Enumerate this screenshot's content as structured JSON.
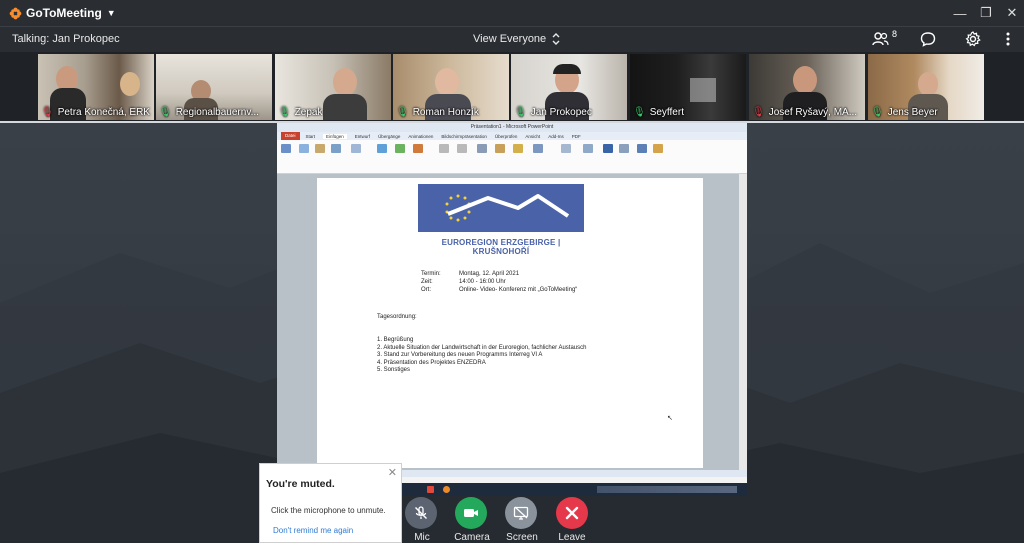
{
  "app": {
    "name": "GoToMeeting"
  },
  "infobar": {
    "talking": "Talking: Jan Prokopec",
    "view_mode": "View Everyone",
    "attendee_count": "8"
  },
  "participants": [
    {
      "name": "Petra Konečná, ERK",
      "muted": true
    },
    {
      "name": "Regionalbauernv...",
      "muted": false
    },
    {
      "name": "Zepak",
      "muted": false
    },
    {
      "name": "Roman Honzík",
      "muted": false
    },
    {
      "name": "Jan Prokopec",
      "muted": false
    },
    {
      "name": "Seyffert",
      "muted": false
    },
    {
      "name": "Josef Ryšavý, MA...",
      "muted": true
    },
    {
      "name": "Jens Beyer",
      "muted": false
    }
  ],
  "presentation": {
    "window_title": "Präsentation1 - Microsoft PowerPoint",
    "tabs": [
      "Datei",
      "Start",
      "Einfügen",
      "Entwurf",
      "Übergänge",
      "Animationen",
      "Bildschirmpräsentation",
      "Überprüfen",
      "Ansicht",
      "Add-Ins",
      "PDF"
    ],
    "logo_text": "EUROREGION ERZGEBIRGE | KRUŠNOHOŘÍ",
    "meta": [
      {
        "key": "Termin:",
        "value": "Montag, 12. April 2021"
      },
      {
        "key": "Zeit:",
        "value": "14:00 - 16:00 Uhr"
      },
      {
        "key": "Ort:",
        "value": "Online- Video- Konferenz mit „GoToMeeting“"
      }
    ],
    "agenda_heading": "Tagesordnung:",
    "agenda": [
      "1. Begrüßung",
      "2. Aktuelle Situation der Landwirtschaft in der Euroregion, fachlicher Austausch",
      "3. Stand zur Vorbereitung des neuen Programms Interreg VI A",
      "4. Präsentation des Projektes ENZEDRA",
      "5. Sonstiges"
    ]
  },
  "muted_popup": {
    "title": "You're muted.",
    "message": "Click the microphone to unmute.",
    "link": "Don't remind me again"
  },
  "controls": {
    "mic": "Mic",
    "camera": "Camera",
    "screen": "Screen",
    "leave": "Leave"
  },
  "colors": {
    "brand_orange": "#f68d2e",
    "camera_green": "#24a85b",
    "leave_red": "#e5384a",
    "mic_gray": "#5b6470",
    "eu_blue": "#4a62a8"
  }
}
